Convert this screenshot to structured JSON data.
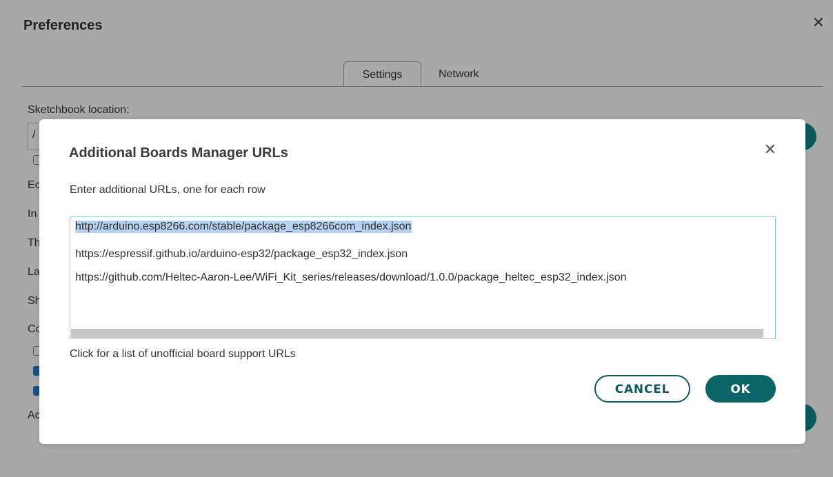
{
  "preferences": {
    "title": "Preferences",
    "close_glyph": "✕",
    "tabs": [
      {
        "label": "Settings",
        "active": true
      },
      {
        "label": "Network",
        "active": false
      }
    ],
    "sketchbook_label": "Sketchbook location:",
    "sketchbook_value_visible": "/",
    "obscured_label_stubs": [
      "Ec",
      "In",
      "Th",
      "La",
      "Sh",
      "Co",
      "Ac"
    ],
    "checkbox_states": [
      false,
      false,
      true,
      true
    ]
  },
  "dialog": {
    "title": "Additional Boards Manager URLs",
    "close_glyph": "✕",
    "description": "Enter additional URLs, one for each row",
    "urls": [
      "http://arduino.esp8266.com/stable/package_esp8266com_index.json",
      "https://espressif.github.io/arduino-esp32/package_esp32_index.json",
      "https://github.com/Heltec-Aaron-Lee/WiFi_Kit_series/releases/download/1.0.0/package_heltec_esp32_index.json"
    ],
    "selected_url_index": 0,
    "link_text": "Click for a list of unofficial board support URLs",
    "cancel_label": "CANCEL",
    "ok_label": "OK"
  },
  "colors": {
    "accent": "#0b6466",
    "selection": "#b5d3f1",
    "overlay": "#a7a7a7"
  }
}
